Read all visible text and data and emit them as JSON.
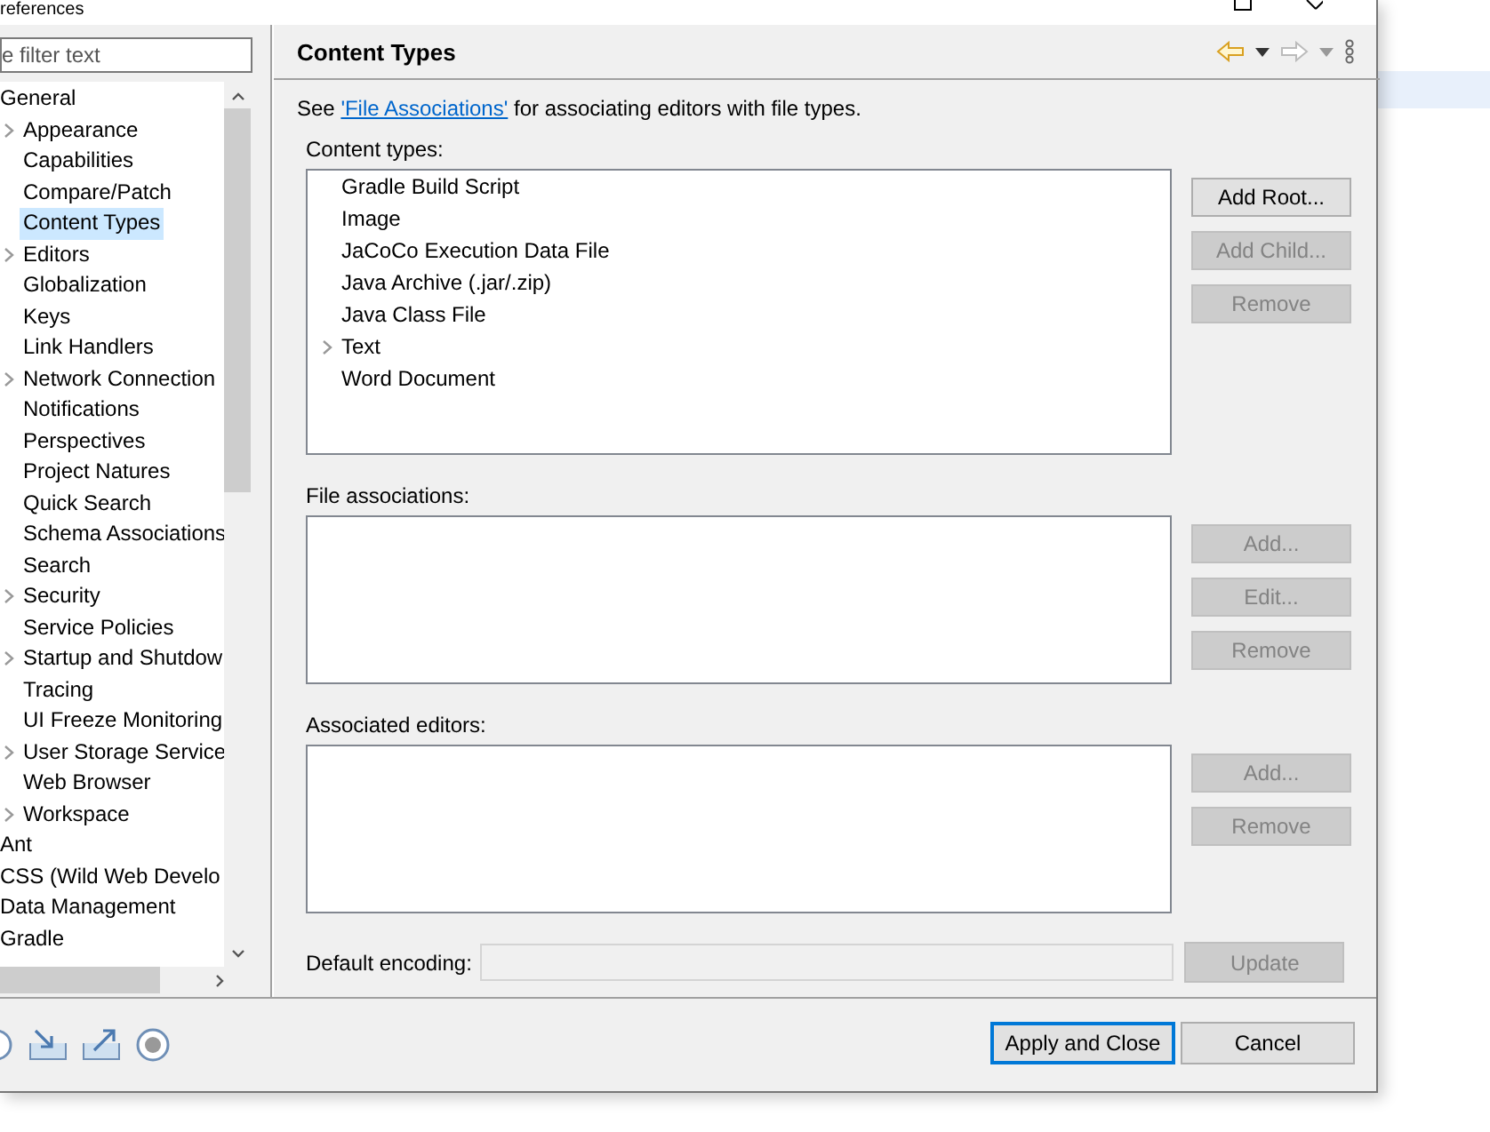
{
  "window": {
    "title": "references"
  },
  "filter": {
    "placeholder": "e filter text"
  },
  "tree": [
    {
      "label": "General",
      "selected": false,
      "children": [
        {
          "label": "Appearance",
          "expandable": true,
          "selected": false
        },
        {
          "label": "Capabilities",
          "expandable": false,
          "selected": false
        },
        {
          "label": "Compare/Patch",
          "expandable": false,
          "selected": false
        },
        {
          "label": "Content Types",
          "expandable": false,
          "selected": true
        },
        {
          "label": "Editors",
          "expandable": true,
          "selected": false
        },
        {
          "label": "Globalization",
          "expandable": false,
          "selected": false
        },
        {
          "label": "Keys",
          "expandable": false,
          "selected": false
        },
        {
          "label": "Link Handlers",
          "expandable": false,
          "selected": false
        },
        {
          "label": "Network Connection",
          "expandable": true,
          "selected": false
        },
        {
          "label": "Notifications",
          "expandable": false,
          "selected": false
        },
        {
          "label": "Perspectives",
          "expandable": false,
          "selected": false
        },
        {
          "label": "Project Natures",
          "expandable": false,
          "selected": false
        },
        {
          "label": "Quick Search",
          "expandable": false,
          "selected": false
        },
        {
          "label": "Schema Associations",
          "expandable": false,
          "selected": false
        },
        {
          "label": "Search",
          "expandable": false,
          "selected": false
        },
        {
          "label": "Security",
          "expandable": true,
          "selected": false
        },
        {
          "label": "Service Policies",
          "expandable": false,
          "selected": false
        },
        {
          "label": "Startup and Shutdow",
          "expandable": true,
          "selected": false
        },
        {
          "label": "Tracing",
          "expandable": false,
          "selected": false
        },
        {
          "label": "UI Freeze Monitoring",
          "expandable": false,
          "selected": false
        },
        {
          "label": "User Storage Service",
          "expandable": true,
          "selected": false
        },
        {
          "label": "Web Browser",
          "expandable": false,
          "selected": false
        },
        {
          "label": "Workspace",
          "expandable": true,
          "selected": false
        }
      ]
    },
    {
      "label": "Ant",
      "selected": false
    },
    {
      "label": "CSS (Wild Web Develo",
      "selected": false
    },
    {
      "label": "Data Management",
      "selected": false
    },
    {
      "label": "Gradle",
      "selected": false
    }
  ],
  "page": {
    "title": "Content Types",
    "intro_before": "See ",
    "intro_link": "'File Associations'",
    "intro_after": " for associating editors with file types.",
    "content_types_label": "Content types:",
    "content_types": [
      {
        "label": "Gradle Build Script",
        "expandable": false
      },
      {
        "label": "Image",
        "expandable": false
      },
      {
        "label": "JaCoCo Execution Data File",
        "expandable": false
      },
      {
        "label": "Java Archive (.jar/.zip)",
        "expandable": false
      },
      {
        "label": "Java Class File",
        "expandable": false
      },
      {
        "label": "Text",
        "expandable": true
      },
      {
        "label": "Word Document",
        "expandable": false
      }
    ],
    "content_type_buttons": [
      {
        "label": "Add Root...",
        "disabled": false
      },
      {
        "label": "Add Child...",
        "disabled": true
      },
      {
        "label": "Remove",
        "disabled": true
      }
    ],
    "file_associations_label": "File associations:",
    "file_association_buttons": [
      {
        "label": "Add...",
        "disabled": true
      },
      {
        "label": "Edit...",
        "disabled": true
      },
      {
        "label": "Remove",
        "disabled": true
      }
    ],
    "associated_editors_label": "Associated editors:",
    "editor_buttons": [
      {
        "label": "Add...",
        "disabled": true
      },
      {
        "label": "Remove",
        "disabled": true
      }
    ],
    "encoding_label": "Default encoding:",
    "update_button": {
      "label": "Update",
      "disabled": true
    }
  },
  "footer_buttons": [
    {
      "label": "Apply and Close",
      "default": true
    },
    {
      "label": "Cancel",
      "default": false
    }
  ]
}
